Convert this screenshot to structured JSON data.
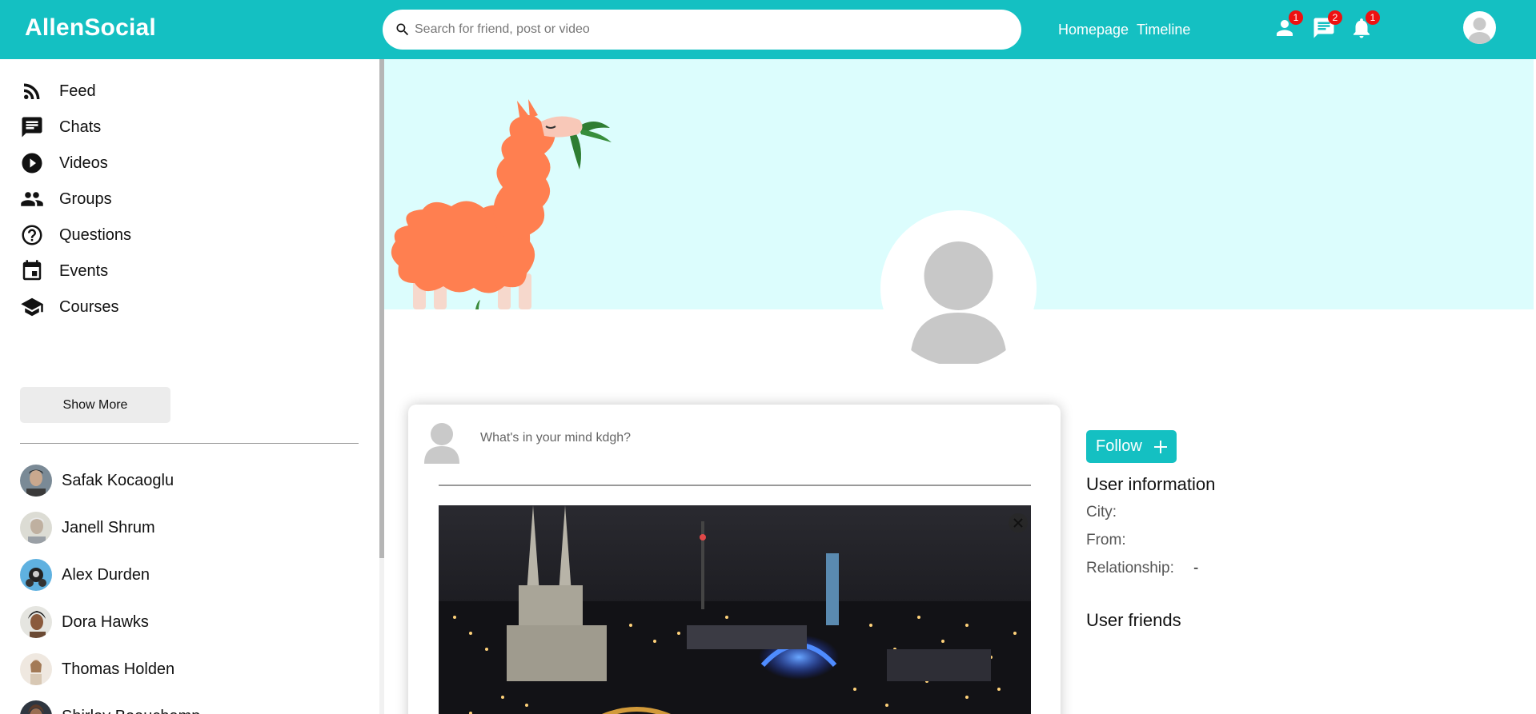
{
  "header": {
    "logo": "AllenSocial",
    "search_placeholder": "Search for friend, post or video",
    "links": [
      "Homepage",
      "Timeline"
    ],
    "notifications": {
      "friend_requests": "1",
      "messages": "2",
      "alerts": "1"
    },
    "colors": {
      "brand": "#14c0c2",
      "badge": "#ee1111"
    }
  },
  "sidebar": {
    "items": [
      {
        "label": "Feed",
        "icon": "rss-icon"
      },
      {
        "label": "Chats",
        "icon": "chat-icon"
      },
      {
        "label": "Videos",
        "icon": "play-circle-icon"
      },
      {
        "label": "Groups",
        "icon": "group-icon"
      },
      {
        "label": "Questions",
        "icon": "help-circle-icon"
      },
      {
        "label": "Events",
        "icon": "calendar-icon"
      },
      {
        "label": "Courses",
        "icon": "school-icon"
      }
    ],
    "show_more": "Show More",
    "friends": [
      {
        "name": "Safak Kocaoglu"
      },
      {
        "name": "Janell Shrum"
      },
      {
        "name": "Alex Durden"
      },
      {
        "name": "Dora Hawks"
      },
      {
        "name": "Thomas Holden"
      },
      {
        "name": "Shirley Beauchamp"
      }
    ]
  },
  "share": {
    "placeholder": "What's in your mind kdgh?"
  },
  "profile": {
    "follow_label": "Follow",
    "user_info_title": "User information",
    "city_label": "City:",
    "city_value": "",
    "from_label": "From:",
    "from_value": "",
    "relationship_label": "Relationship:",
    "relationship_value": "-",
    "friends_title": "User friends"
  }
}
